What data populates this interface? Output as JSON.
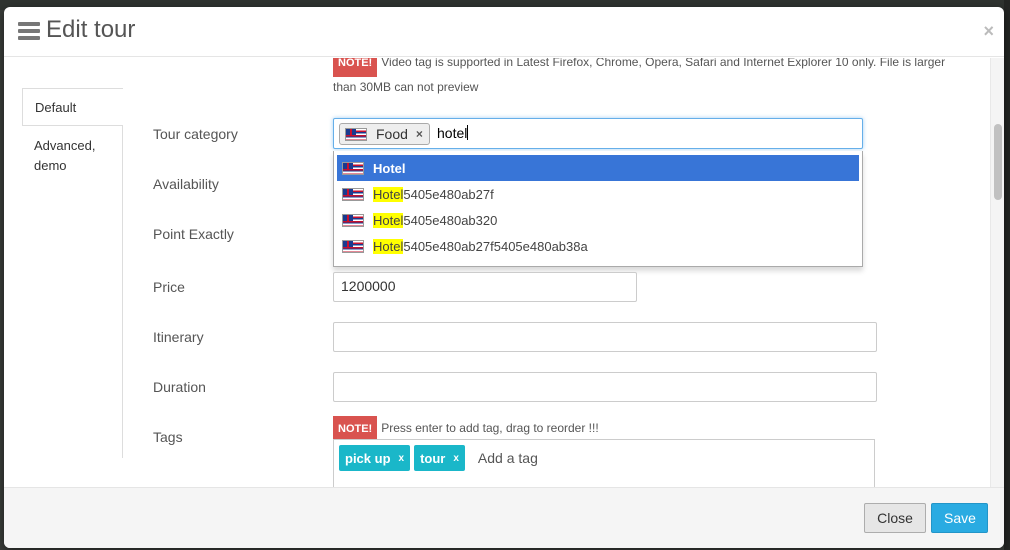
{
  "modal": {
    "title": "Edit tour",
    "close_glyph": "×"
  },
  "tabs": [
    {
      "label": "Default",
      "active": true
    },
    {
      "label": "Advanced, demo",
      "active": false
    }
  ],
  "note_top": {
    "badge": "NOTE!",
    "text": "Video tag is supported in Latest Firefox, Chrome, Opera, Safari and Internet Explorer 10 only. File is larger than 30MB can not preview"
  },
  "fields": {
    "tour_category": "Tour category",
    "availability": "Availability",
    "point_exactly": "Point Exactly",
    "price": "Price",
    "itinerary": "Itinerary",
    "duration": "Duration",
    "tags": "Tags"
  },
  "category": {
    "selected_chip": "Food",
    "chip_remove": "×",
    "search_value": "hotel",
    "dropdown": [
      {
        "highlight": "",
        "rest": "Hotel",
        "selected": true
      },
      {
        "highlight": "Hotel",
        "rest": "5405e480ab27f",
        "selected": false
      },
      {
        "highlight": "Hotel",
        "rest": "5405e480ab320",
        "selected": false
      },
      {
        "highlight": "Hotel",
        "rest": "5405e480ab27f5405e480ab38a",
        "selected": false
      }
    ]
  },
  "price_value": "1200000",
  "itinerary_value": "",
  "duration_value": "",
  "tags_note": {
    "badge": "NOTE!",
    "text": "Press enter to add tag, drag to reorder !!!"
  },
  "tags": {
    "items": [
      {
        "label": "pick up",
        "remove": "x"
      },
      {
        "label": "tour",
        "remove": "x"
      }
    ],
    "placeholder": "Add a tag"
  },
  "footer": {
    "close_label": "Close",
    "save_label": "Save"
  },
  "colors": {
    "primary": "#2aabe2",
    "note": "#d9534f",
    "tag": "#1ab7c9",
    "select": "#3875d7",
    "highlight": "#ffff00"
  },
  "icons": {
    "menu": "menu-icon",
    "flag": "flag-icon"
  }
}
